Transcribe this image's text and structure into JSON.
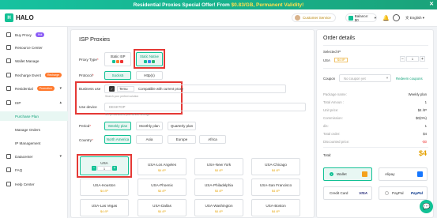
{
  "banner": {
    "text_a": "Residential Proxies Special Offer! From ",
    "text_b": "$0.83/GB, Permanent Validity!",
    "close": "✕"
  },
  "header": {
    "logo": "HALO",
    "customer_service": "Customer Service",
    "balance": "Balance: $0",
    "language": "English"
  },
  "sidebar": {
    "items": [
      {
        "label": "Buy Proxy",
        "tag": "Hot"
      },
      {
        "label": "Resource Center"
      },
      {
        "label": "Wallet Manage"
      },
      {
        "label": "Recharge Event",
        "tag": "Recharge"
      },
      {
        "label": "Residential",
        "tag": "Promotion"
      },
      {
        "label": "ISP"
      },
      {
        "label": "Purchase Plan"
      },
      {
        "label": "Manage Orders"
      },
      {
        "label": "IP Management"
      },
      {
        "label": "Datacenter"
      },
      {
        "label": "FAQ"
      },
      {
        "label": "Help Center"
      }
    ]
  },
  "isp": {
    "title": "ISP Proxies",
    "proxy_type_label": "Proxy Type",
    "types": [
      {
        "name": "Static ISP"
      },
      {
        "name": "Static Native"
      }
    ],
    "protocol_label": "Protocol",
    "protocols": [
      "Socks5",
      "Http(s)"
    ],
    "business_use_label": "Business use",
    "business_use_value": "Temu",
    "business_use_status": "Compatible with current proxy",
    "business_use_hint": "Search your perfect solution",
    "use_device_label": "Use device",
    "use_device_value": "DESKTOP",
    "use_device_hint": "Set personalized your device settings",
    "period_label": "Period",
    "periods": [
      "Weekly plan",
      "Monthly plan",
      "Quarterly plan"
    ],
    "country_label": "Country",
    "countries": [
      "North America",
      "Asia",
      "Europe",
      "Africa"
    ],
    "locations": [
      {
        "name": "USA",
        "price": "",
        "qty": "1"
      },
      {
        "name": "USA-Los Angeles",
        "price": "$4 /IP"
      },
      {
        "name": "USA-New York",
        "price": "$4 /IP"
      },
      {
        "name": "USA-Chicago",
        "price": "$4 /IP"
      },
      {
        "name": "USA-Houston",
        "price": "$4 /IP"
      },
      {
        "name": "USA-Phoenix",
        "price": "$4 /IP"
      },
      {
        "name": "USA-Philadelphia",
        "price": "$4 /IP"
      },
      {
        "name": "USA-San Francisco",
        "price": "$4 /IP"
      },
      {
        "name": "USA-Las Vegas",
        "price": "$4 /IP"
      },
      {
        "name": "USA-Dallas",
        "price": "$4 /IP"
      },
      {
        "name": "USA-Washington",
        "price": "$4 /IP"
      },
      {
        "name": "USA-Boston",
        "price": "$4 /IP"
      }
    ]
  },
  "order": {
    "title": "Order details",
    "selected_ip_label": "Selected IP",
    "selected_country": "USA",
    "selected_price": "$4 /IP",
    "qty": "1",
    "coupon_label": "Coupon",
    "coupon_placeholder": "No coupon yet",
    "redeem": "Redeem coupons",
    "rows": [
      {
        "k": "Package name:",
        "v": "Weekly plan"
      },
      {
        "k": "Total Amoun :",
        "v": "1"
      },
      {
        "k": "Unit price:",
        "v": "$4 /IP"
      },
      {
        "k": "Commission:",
        "v": "$0(0%)"
      },
      {
        "k": "dis:",
        "v": "1"
      },
      {
        "k": "Total order:",
        "v": "$4"
      },
      {
        "k": "Discounted price:",
        "v": "-$0"
      }
    ],
    "total_label": "Total:",
    "total_value": "$4",
    "payments": [
      "Wallet",
      "Alipay",
      "Credit Card",
      "PayPal"
    ],
    "visa": "VISA",
    "paypal": "PayPal"
  }
}
